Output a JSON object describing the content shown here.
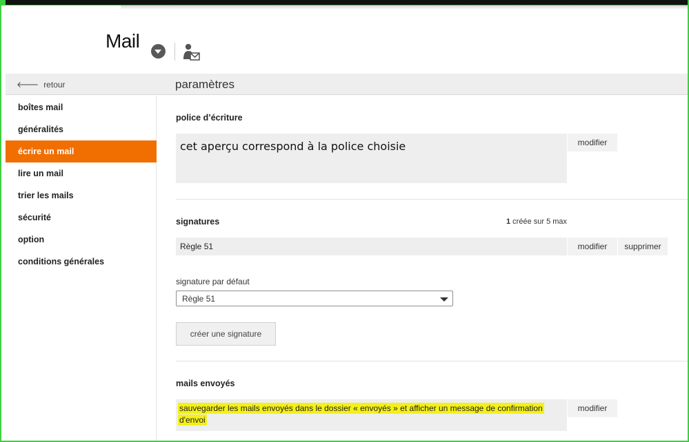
{
  "header": {
    "app_title": "Mail"
  },
  "subbar": {
    "back_label": "retour",
    "section_title": "paramètres"
  },
  "sidebar": {
    "items": [
      {
        "label": "boîtes mail",
        "active": false
      },
      {
        "label": "généralités",
        "active": false
      },
      {
        "label": "écrire un mail",
        "active": true
      },
      {
        "label": "lire un mail",
        "active": false
      },
      {
        "label": "trier les mails",
        "active": false
      },
      {
        "label": "sécurité",
        "active": false
      },
      {
        "label": "option",
        "active": false
      },
      {
        "label": "conditions générales",
        "active": false
      }
    ]
  },
  "font_section": {
    "title": "police d’écriture",
    "preview": "cet aperçu correspond à la police choisie",
    "modify_label": "modifier"
  },
  "signatures_section": {
    "title": "signatures",
    "count_value": "1",
    "count_suffix": " créée sur 5 max",
    "signature_name": "Règle 51",
    "modify_label": "modifier",
    "delete_label": "supprimer",
    "default_label": "signature par défaut",
    "default_value": "Règle 51",
    "create_label": "créer une signature"
  },
  "sent_section": {
    "title": "mails envoyés",
    "description_line1": "sauvegarder les mails envoyés dans le dossier « envoyés » et afficher un message de confirmation",
    "description_line2": "d'envoi",
    "modify_label": "modifier"
  },
  "colors": {
    "accent": "#f16e00",
    "highlight": "#f4f019",
    "frame": "#3fcf3f"
  }
}
